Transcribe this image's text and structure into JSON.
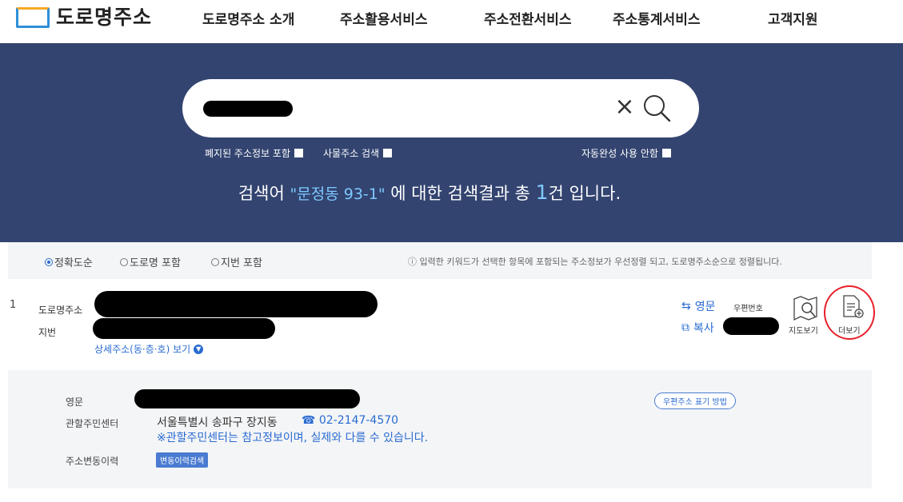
{
  "header": {
    "logo_text": "도로명주소",
    "nav": [
      "도로명주소 소개",
      "주소활용서비스",
      "주소전환서비스",
      "주소통계서비스",
      "고객지원"
    ]
  },
  "search": {
    "clear_glyph": "×",
    "options": {
      "abolished": "폐지된 주소정보 포함",
      "thing": "사물주소 검색",
      "autocomplete": "자동완성 사용 안함"
    },
    "result_prefix": "검색어",
    "keyword": "\"문정동 93-1\"",
    "result_mid": "에 대한 검색결과 총",
    "count": "1",
    "result_suffix": "건 입니다."
  },
  "sort": {
    "exact": "정확도순",
    "road": "도로명 포함",
    "jibun": "지번 포함",
    "note": "ⓘ 입력한 키워드가 선택한 항목에 포함되는 주소정보가 우선정렬 되고, 도로명주소순으로 정렬됩니다."
  },
  "result": {
    "number": "1",
    "road_label": "도로명주소",
    "jibun_label": "지번",
    "detail_link": "상세주소(동·층·호) 보기",
    "english_btn": "영문",
    "copy_btn": "복사",
    "postal_label": "우편번호",
    "map_label": "지도보기",
    "more_label": "더보기"
  },
  "panel": {
    "english_label": "영문",
    "center_label": "관할주민센터",
    "center_value": "서울특별시 송파구 장지동",
    "phone": "☎ 02-2147-4570",
    "center_note": "※관할주민센터는 참고정보이며, 실제와 다를 수 있습니다.",
    "history_label": "주소변동이력",
    "history_btn": "변동이력검색",
    "postal_format_btn": "우편주소 표기 방법"
  },
  "colors": {
    "banner": "#334470",
    "accent": "#2a6bd1",
    "highlight": "#7ec8ff",
    "annotation": "#e8202a"
  }
}
